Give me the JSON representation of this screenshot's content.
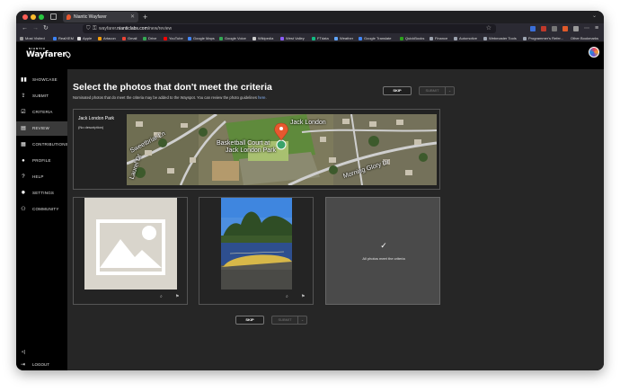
{
  "browser": {
    "tab_title": "Niantic Wayfarer",
    "url_prefix": "wayfarer.",
    "url_host": "nianticlabs.com",
    "url_path": "/new/review",
    "bookmarks": [
      {
        "label": "Most Visited",
        "color": "#999999"
      },
      {
        "label": "RealXEM",
        "color": "#3b82f6"
      },
      {
        "label": "Apple",
        "color": "#dddddd"
      },
      {
        "label": "Artacon",
        "color": "#f59e0b"
      },
      {
        "label": "Gmail",
        "color": "#ea4335"
      },
      {
        "label": "Drive",
        "color": "#34a853"
      },
      {
        "label": "YouTube",
        "color": "#ff0000"
      },
      {
        "label": "Google Maps",
        "color": "#4285f4"
      },
      {
        "label": "Google Voice",
        "color": "#34a853"
      },
      {
        "label": "Wikipedia",
        "color": "#cccccc"
      },
      {
        "label": "West Valley",
        "color": "#8b5cf6"
      },
      {
        "label": "FTdata",
        "color": "#10b981"
      },
      {
        "label": "Weather",
        "color": "#60a5fa"
      },
      {
        "label": "Google Translate",
        "color": "#4285f4"
      },
      {
        "label": "QuickBooks",
        "color": "#2ca01c"
      },
      {
        "label": "Finance",
        "color": "#9ca3af"
      },
      {
        "label": "Automotive",
        "color": "#9ca3af"
      },
      {
        "label": "Webmaster Tools",
        "color": "#9ca3af"
      },
      {
        "label": "Programmer's Refer...",
        "color": "#9ca3af"
      }
    ],
    "other_bookmarks": "Other Bookmarks"
  },
  "app": {
    "brand_small": "NIANTIC",
    "brand": "Wayfarer"
  },
  "sidebar": {
    "items": [
      {
        "label": "SHOWCASE",
        "icon": "▮▮"
      },
      {
        "label": "SUBMIT",
        "icon": "⇪"
      },
      {
        "label": "CRITERIA",
        "icon": "☑"
      },
      {
        "label": "REVIEW",
        "icon": "▤"
      },
      {
        "label": "CONTRIBUTIONS",
        "icon": "▦"
      },
      {
        "label": "PROFILE",
        "icon": "●"
      },
      {
        "label": "HELP",
        "icon": "?"
      },
      {
        "label": "SETTINGS",
        "icon": "✹"
      },
      {
        "label": "COMMUNITY",
        "icon": "⚇"
      }
    ],
    "active_index": 3,
    "collapse_label": "<|",
    "logout_label": "LOGOUT"
  },
  "review": {
    "title": "Select the photos that don't meet the criteria",
    "subtitle_prefix": "Nominated photos that do meet the criteria may be added to the Wayspot. You can review the photo guidelines ",
    "subtitle_link": "here",
    "subtitle_suffix": ".",
    "skip_label": "SKIP",
    "submit_label": "SUBMIT",
    "caret_label": "⌄",
    "poi_name": "Jack London Park",
    "poi_description": "(No description)",
    "map_labels": {
      "park_top": "Jack London",
      "park_court": "Basketball Court at",
      "park_name": "Jack London Park",
      "street_1": "Sweetbriar Ln",
      "street_2": "Laurel Dr",
      "street_3": "Morning Glory Dr"
    },
    "none_meet_label": "All photos meet the criteria",
    "accent_color": "#e8582f"
  }
}
